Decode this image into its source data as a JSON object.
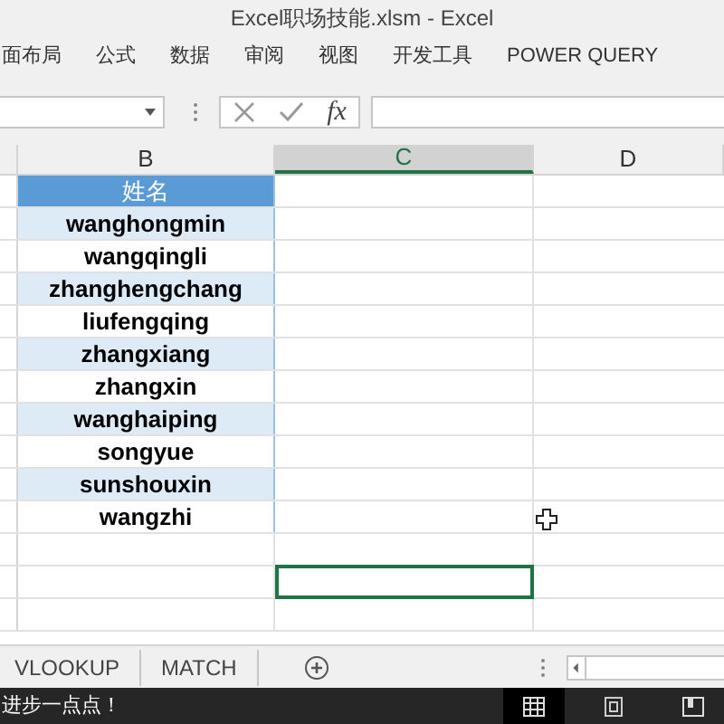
{
  "window": {
    "title": "Excel职场技能.xlsm - Excel"
  },
  "ribbon_tabs": [
    {
      "label": "面布局"
    },
    {
      "label": "公式"
    },
    {
      "label": "数据"
    },
    {
      "label": "审阅"
    },
    {
      "label": "视图"
    },
    {
      "label": "开发工具"
    },
    {
      "label": "POWER QUERY"
    }
  ],
  "formula_bar": {
    "function_label": "fx"
  },
  "columns": [
    {
      "label": "B",
      "selected": false
    },
    {
      "label": "C",
      "selected": true
    },
    {
      "label": "D",
      "selected": false
    }
  ],
  "rows": [
    {
      "kind": "header",
      "name": "姓名"
    },
    {
      "kind": "band",
      "name": "wanghongmin"
    },
    {
      "kind": "plain",
      "name": "wangqingli"
    },
    {
      "kind": "band",
      "name": "zhanghengchang"
    },
    {
      "kind": "plain",
      "name": "liufengqing"
    },
    {
      "kind": "band",
      "name": "zhangxiang"
    },
    {
      "kind": "plain",
      "name": "zhangxin"
    },
    {
      "kind": "band",
      "name": "wanghaiping"
    },
    {
      "kind": "plain",
      "name": "songyue"
    },
    {
      "kind": "band",
      "name": "sunshouxin"
    },
    {
      "kind": "plain",
      "name": "wangzhi"
    },
    {
      "kind": "empty",
      "selected": false
    },
    {
      "kind": "empty",
      "selected": true
    },
    {
      "kind": "empty",
      "selected": false
    }
  ],
  "sheet_tabs": [
    {
      "label": "VLOOKUP",
      "selected": false
    },
    {
      "label": "MATCH",
      "selected": false
    }
  ],
  "status_bar": {
    "text": "进步一点点！",
    "views": [
      {
        "kind": "normal",
        "selected": true
      },
      {
        "kind": "page_layout",
        "selected": false
      },
      {
        "kind": "page_break",
        "selected": false
      }
    ]
  }
}
